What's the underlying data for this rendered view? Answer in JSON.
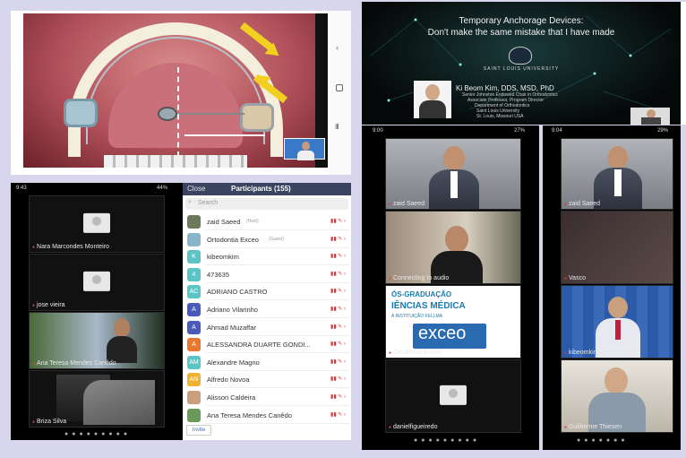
{
  "dental_slide": {
    "description_hidden": true
  },
  "lecture": {
    "title_line1": "Temporary Anchorage Devices:",
    "title_line2": "Don't make the same mistake that I have made",
    "university": "SAINT LOUIS UNIVERSITY",
    "presenter": "Ki Beom Kim, DDS, MSD, PhD",
    "role1": "Senior Johnston Endowed Chair in Orthodontics",
    "role2": "Associate Professor, Program Director",
    "role3": "Department of Orthodontics",
    "role4": "Saint Louis University",
    "role5": "St. Louis, Missouri USA"
  },
  "phone1": {
    "time": "9:43",
    "battery": "44%",
    "tiles": [
      "Nara Marcondes Monteiro",
      "jose vieira",
      "Ana Teresa Mendes Canêdo",
      "Briza Silva"
    ]
  },
  "participants": {
    "close": "Close",
    "title": "Participants (155)",
    "search_placeholder": "Search",
    "invite": "Invite",
    "list": [
      {
        "name": "zaid Saeed",
        "tag": "(Host)",
        "avatar": "",
        "color": "#6a7a5a"
      },
      {
        "name": "Ortodontia Exceo",
        "tag": "(Guest)",
        "avatar": "",
        "color": "#8ab4c8"
      },
      {
        "name": "kibeomkim",
        "tag": "",
        "avatar": "K",
        "color": "#5cc4c4"
      },
      {
        "name": "473635",
        "tag": "",
        "avatar": "4",
        "color": "#5cc4c4"
      },
      {
        "name": "ADRIANO CASTRO",
        "tag": "",
        "avatar": "AC",
        "color": "#5cc4c4"
      },
      {
        "name": "Adriano Vilarinho",
        "tag": "",
        "avatar": "A",
        "color": "#4a5ab8"
      },
      {
        "name": "Ahmad Muzaffar",
        "tag": "",
        "avatar": "A",
        "color": "#4a5ab8"
      },
      {
        "name": "ALESSANDRA DUARTE GONDI...",
        "tag": "",
        "avatar": "A",
        "color": "#e87830"
      },
      {
        "name": "Alexandre Magno",
        "tag": "",
        "avatar": "AM",
        "color": "#5cc4c4"
      },
      {
        "name": "Alfredo Novoa",
        "tag": "",
        "avatar": "AN",
        "color": "#f0b030"
      },
      {
        "name": "Alisson Caldeira",
        "tag": "",
        "avatar": "",
        "color": "#c8a080"
      },
      {
        "name": "Ana Teresa Mendes Canêdo",
        "tag": "",
        "avatar": "",
        "color": "#6a9a5a"
      }
    ]
  },
  "phone2": {
    "time": "9:00",
    "battery": "27%",
    "tiles": [
      "zaid Saeed",
      "Connecting to audio",
      "Ortodontia Exceo",
      "danielfigueiredo"
    ],
    "exceo_line1": "ÓS-GRADUAÇÃO",
    "exceo_line2": "IÊNCIAS MÉDICA",
    "exceo_line3": "A INSTITUIÇÃO FELLMA",
    "exceo_logo": "exceo"
  },
  "phone3": {
    "time": "9:04",
    "battery": "29%",
    "tiles": [
      "zaid Saeed",
      "Vasco",
      "kibeomkim",
      "Guilherme Thiesen"
    ]
  }
}
